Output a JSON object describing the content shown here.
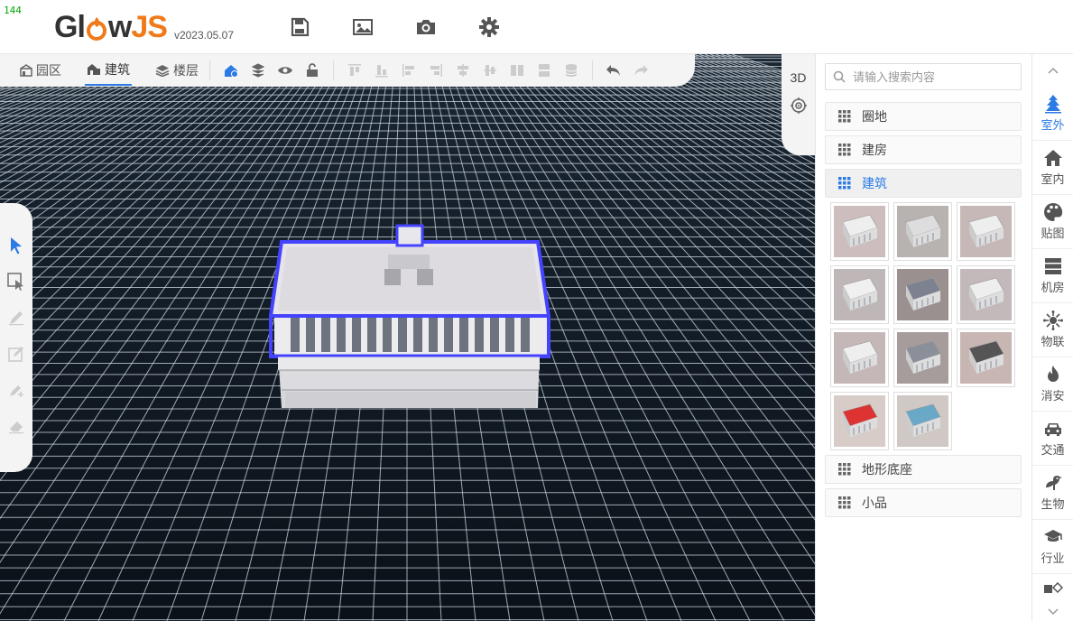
{
  "fps": "144",
  "app": {
    "logo_left": "Gl",
    "logo_middle": "w",
    "logo_right": "JS",
    "version": "v2023.05.07"
  },
  "header_tools": [
    "save-icon",
    "image-icon",
    "camera-icon",
    "settings-icon"
  ],
  "toolbar": {
    "tabs": [
      {
        "label": "园区",
        "icon": "park-icon"
      },
      {
        "label": "建筑",
        "icon": "building-icon",
        "active": true
      },
      {
        "label": "楼层",
        "icon": "layers-icon"
      }
    ]
  },
  "view_toggle": {
    "label": "3D"
  },
  "search": {
    "placeholder": "请输入搜索内容",
    "value": ""
  },
  "categories": [
    {
      "label": "圈地"
    },
    {
      "label": "建房"
    },
    {
      "label": "建筑",
      "active": true
    },
    {
      "label": "地形底座"
    },
    {
      "label": "小品"
    }
  ],
  "side_nav": [
    {
      "label": "室外",
      "icon": "tree-icon",
      "active": true
    },
    {
      "label": "室内",
      "icon": "home-icon"
    },
    {
      "label": "贴图",
      "icon": "palette-icon"
    },
    {
      "label": "机房",
      "icon": "server-icon"
    },
    {
      "label": "物联",
      "icon": "iot-icon"
    },
    {
      "label": "消安",
      "icon": "fire-icon"
    },
    {
      "label": "交通",
      "icon": "car-icon"
    },
    {
      "label": "生物",
      "icon": "bird-icon"
    },
    {
      "label": "行业",
      "icon": "graduation-icon"
    }
  ],
  "colors": {
    "accent": "#2c7be5",
    "logo_orange": "#f07a1a",
    "viewport_bg": "#0d1620",
    "selection": "#3a3aff"
  }
}
